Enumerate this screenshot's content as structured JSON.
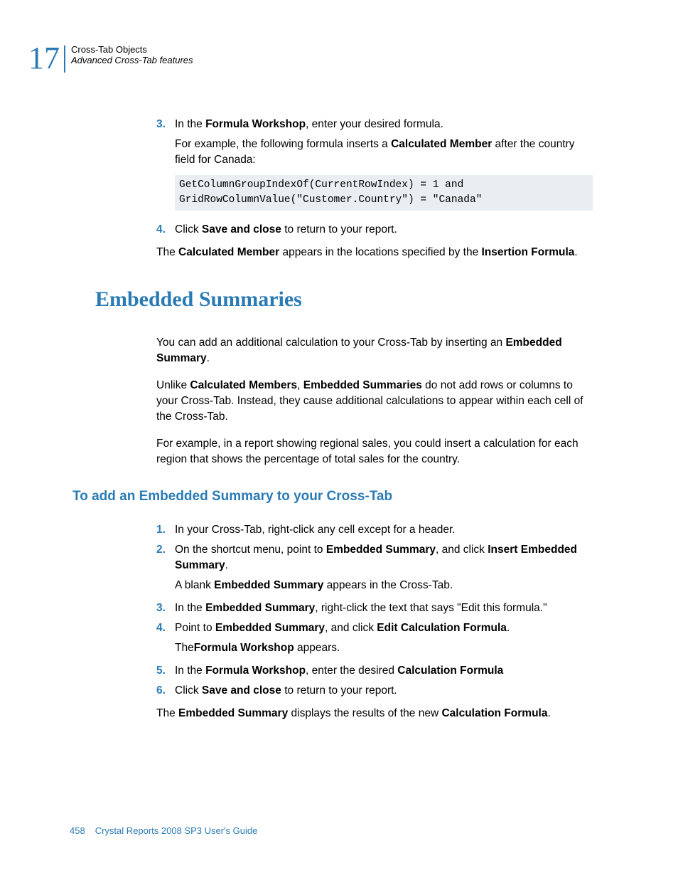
{
  "header": {
    "chapter": "17",
    "line1": "Cross-Tab Objects",
    "line2": "Advanced Cross-Tab features"
  },
  "s1": {
    "n3": "3.",
    "l3a": "In the ",
    "l3b": "Formula Workshop",
    "l3c": ", enter your desired formula.",
    "sub3a": "For example, the following formula inserts a ",
    "sub3b": "Calculated Member",
    "sub3c": " after the country field for Canada:",
    "code": "GetColumnGroupIndexOf(CurrentRowIndex) = 1 and\nGridRowColumnValue(\"Customer.Country\") = \"Canada\"",
    "n4": "4.",
    "l4a": "Click ",
    "l4b": "Save and close",
    "l4c": " to return to your report.",
    "p1a": "The ",
    "p1b": "Calculated Member",
    "p1c": " appears in the locations specified by the ",
    "p1d": "Insertion Formula",
    "p1e": "."
  },
  "h1": "Embedded Summaries",
  "s2": {
    "p1a": "You can add an additional calculation to your Cross-Tab by inserting an ",
    "p1b": "Embedded Summary",
    "p1c": ".",
    "p2a": "Unlike ",
    "p2b": "Calculated Members",
    "p2c": ", ",
    "p2d": "Embedded Summaries",
    "p2e": " do not add rows or columns to your Cross-Tab. Instead, they cause additional calculations to appear within each cell of the Cross-Tab.",
    "p3": "For example, in a report showing regional sales, you could insert a calculation for each region that shows the percentage of total sales for the country."
  },
  "h2": "To add an Embedded Summary to your Cross-Tab",
  "s3": {
    "n1": "1.",
    "l1": "In your Cross-Tab, right-click any cell except for a header.",
    "n2": "2.",
    "l2a": "On the shortcut menu, point to ",
    "l2b": "Embedded Summary",
    "l2c": ", and click ",
    "l2d": "Insert Embedded Summary",
    "l2e": ".",
    "sub2a": "A blank ",
    "sub2b": "Embedded Summary",
    "sub2c": " appears in the Cross-Tab.",
    "n3": "3.",
    "l3a": "In the ",
    "l3b": "Embedded Summary",
    "l3c": ", right-click the text that says \"Edit this formula.\"",
    "n4": "4.",
    "l4a": "Point to ",
    "l4b": "Embedded Summary",
    "l4c": ", and click ",
    "l4d": "Edit Calculation Formula",
    "l4e": ".",
    "sub4a": "The",
    "sub4b": "Formula Workshop",
    "sub4c": " appears.",
    "n5": "5.",
    "l5a": "In the ",
    "l5b": "Formula Workshop",
    "l5c": ", enter the desired ",
    "l5d": "Calculation Formula",
    "n6": "6.",
    "l6a": "Click ",
    "l6b": "Save and close",
    "l6c": " to return to your report.",
    "p1a": "The ",
    "p1b": "Embedded Summary",
    "p1c": " displays the results of the new ",
    "p1d": "Calculation Formula",
    "p1e": "."
  },
  "footer": {
    "page": "458",
    "title": "Crystal Reports 2008 SP3 User's Guide"
  }
}
